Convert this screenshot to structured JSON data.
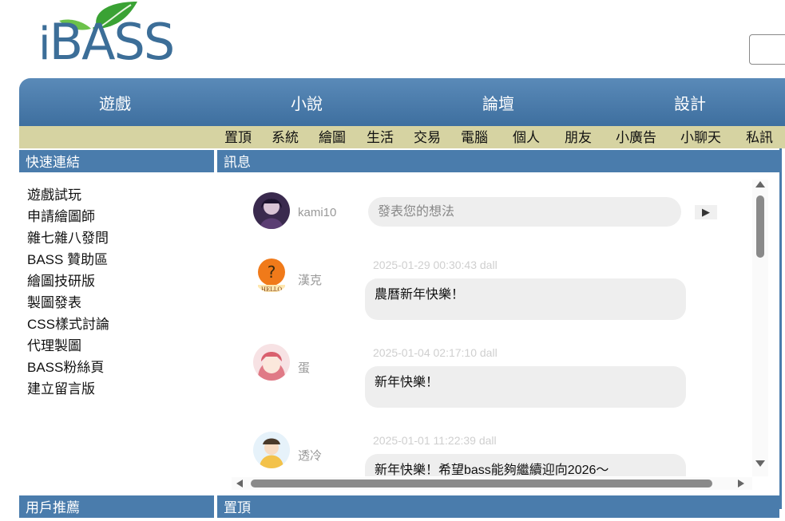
{
  "header": {
    "logo_text": "iBASS",
    "logo_prefix": "i",
    "logo_main": "BASS"
  },
  "main_nav": [
    {
      "label": "遊戲"
    },
    {
      "label": "小說"
    },
    {
      "label": "論壇"
    },
    {
      "label": "設計"
    }
  ],
  "sub_nav": [
    {
      "label": "置頂"
    },
    {
      "label": "系統"
    },
    {
      "label": "繪圖"
    },
    {
      "label": "生活"
    },
    {
      "label": "交易"
    },
    {
      "label": "電腦"
    },
    {
      "label": "個人"
    },
    {
      "label": "朋友"
    },
    {
      "label": "小廣告"
    },
    {
      "label": "小聊天"
    },
    {
      "label": "私訊"
    }
  ],
  "quick_links": {
    "title": "快速連結",
    "items": [
      {
        "label": "遊戲試玩"
      },
      {
        "label": "申請繪圖師"
      },
      {
        "label": "雜七雜八發問"
      },
      {
        "label": "BASS 贊助區"
      },
      {
        "label": "繪圖技研版"
      },
      {
        "label": "製圖發表"
      },
      {
        "label": "CSS樣式討論"
      },
      {
        "label": "代理製圖"
      },
      {
        "label": "BASS粉絲頁"
      },
      {
        "label": "建立留言版"
      }
    ]
  },
  "messages": {
    "title": "訊息",
    "current_user": "kami10",
    "input_placeholder": "發表您的想法",
    "send_label": "▶",
    "posts": [
      {
        "user": "漢克",
        "meta": "2025-01-29 00:30:43 dall",
        "text": "農曆新年快樂！",
        "avatar_text": "HELLO"
      },
      {
        "user": "蛋",
        "meta": "2025-01-04 02:17:10 dall",
        "text": "新年快樂！"
      },
      {
        "user": "透冷",
        "meta": "2025-01-01 11:22:39 dall",
        "text": "新年快樂！希望bass能夠繼續迎向2026～"
      }
    ]
  },
  "bottom": {
    "left_title": "用戶推薦",
    "right_title": "置頂"
  },
  "colors": {
    "nav_blue": "#4a7cac",
    "sub_nav_tan": "#d6d3a2",
    "logo_green": "#3aa234"
  }
}
